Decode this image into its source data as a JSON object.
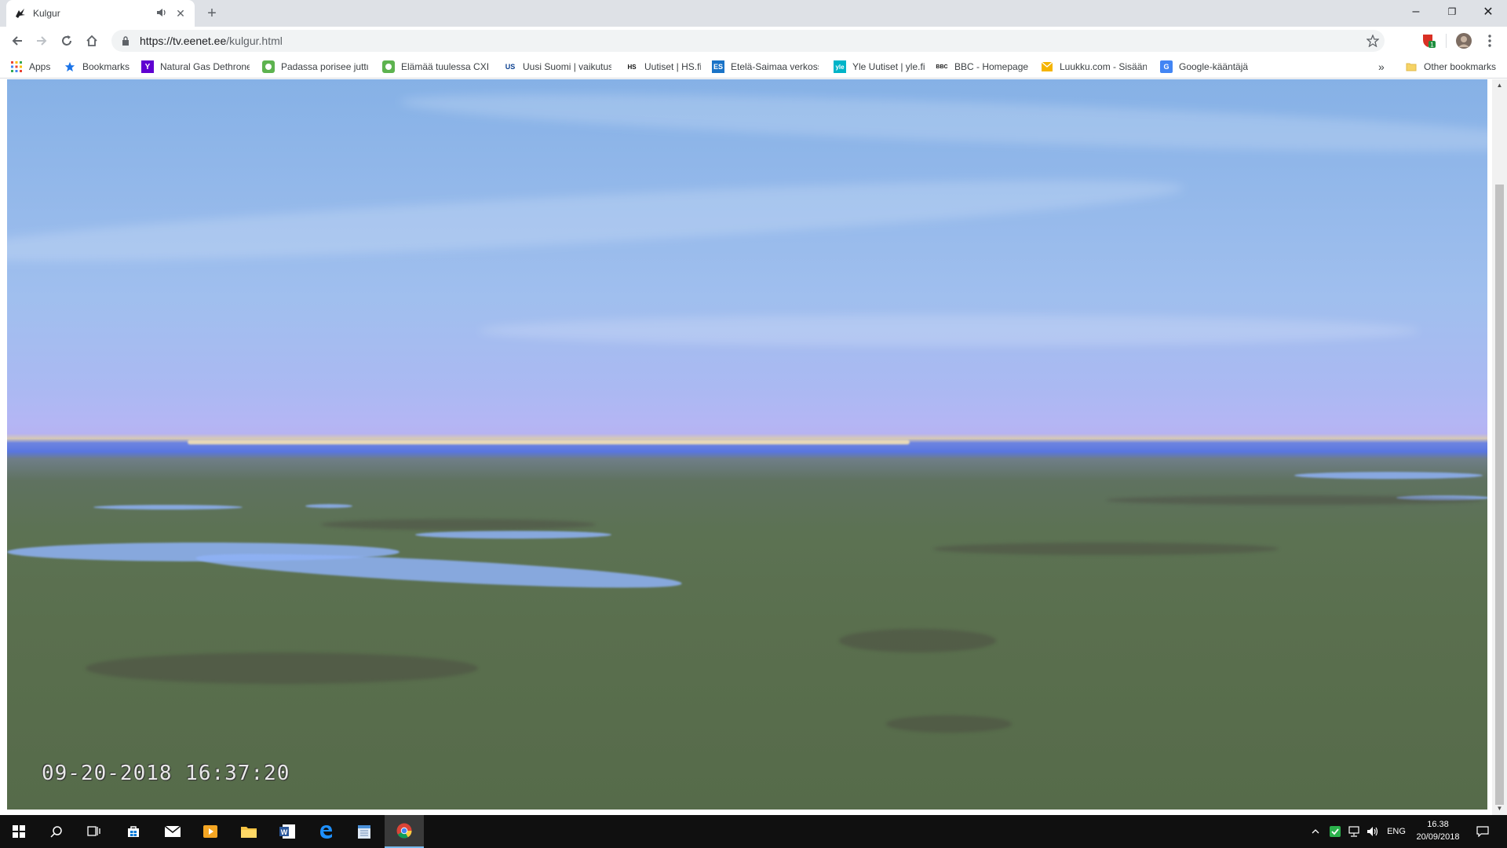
{
  "tab": {
    "title": "Kulgur"
  },
  "window": {
    "minimize": "–",
    "restore": "❐",
    "close": "✕"
  },
  "address": {
    "host": "https://tv.eenet.ee",
    "path": "/kulgur.html"
  },
  "bookmarks": {
    "items": [
      {
        "label": "Apps",
        "icon": "apps-grid-icon"
      },
      {
        "label": "Bookmarks",
        "icon": "star-icon"
      },
      {
        "label": "Natural Gas Dethrone",
        "icon": "yahoo-icon",
        "glyph": "Y"
      },
      {
        "label": "Padassa porisee juttu",
        "icon": "green-square-icon"
      },
      {
        "label": "Elämää tuulessa CXIII",
        "icon": "green-square-icon"
      },
      {
        "label": "Uusi Suomi | vaikutus",
        "icon": "us-icon",
        "glyph": "US"
      },
      {
        "label": "Uutiset | HS.fi",
        "icon": "hs-icon",
        "glyph": "HS"
      },
      {
        "label": "Etelä-Saimaa verkoss",
        "icon": "es-icon",
        "glyph": "ES"
      },
      {
        "label": "Yle Uutiset | yle.fi",
        "icon": "yle-icon",
        "glyph": "yle"
      },
      {
        "label": "BBC - Homepage",
        "icon": "bbc-icon",
        "glyph": "BBC"
      },
      {
        "label": "Luukku.com - Sisäänk",
        "icon": "luukku-icon"
      },
      {
        "label": "Google-kääntäjä",
        "icon": "google-translate-icon",
        "glyph": "G"
      }
    ],
    "overflow": "»",
    "other": "Other bookmarks"
  },
  "camera": {
    "timestamp": "09-20-2018 16:37:20"
  },
  "taskbar": {
    "language": "ENG",
    "time": "16.38",
    "date": "20/09/2018"
  }
}
